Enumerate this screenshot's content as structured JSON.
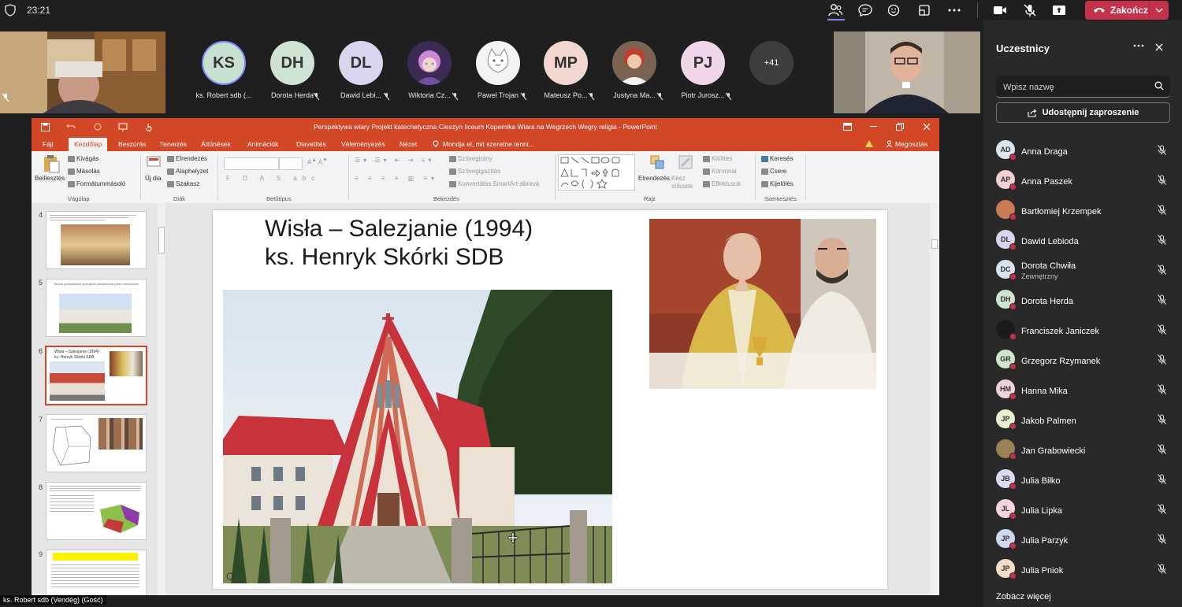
{
  "topbar": {
    "time": "23:21",
    "end_call_label": "Zakończ"
  },
  "strip": {
    "participants": [
      {
        "initials": "KS",
        "name": "ks. Robert sdb (...",
        "color": "#c8e0cf"
      },
      {
        "initials": "DH",
        "name": "Dorota Herda",
        "color": "#cfe3d3"
      },
      {
        "initials": "DL",
        "name": "Dawid Lebi...",
        "color": "#d8d6ef"
      },
      {
        "initials": "",
        "name": "Wiktoria Cz...",
        "color": "#7b5aa6"
      },
      {
        "initials": "",
        "name": "Paweł Trojan",
        "color": "#f4f4f4"
      },
      {
        "initials": "MP",
        "name": "Mateusz Po...",
        "color": "#f1d7cf"
      },
      {
        "initials": "",
        "name": "Justyna Ma...",
        "color": "#d8b28f"
      },
      {
        "initials": "PJ",
        "name": "Piotr Jurosz...",
        "color": "#f0d6e8"
      }
    ],
    "more_count": "+41"
  },
  "ppt": {
    "window_title": "Perspektywa wiary Projekt katechetyczna Cieszyn liceum Kopemika Wiara na Wegrzech Wegry religia - PowerPoint",
    "tabs": [
      "Fájl",
      "Kezdőlap",
      "Beszúrás",
      "Tervezés",
      "Áttűnések",
      "Animációk",
      "Diavetítés",
      "Véleményezés",
      "Nézet"
    ],
    "tell_me": "Mondja el, mit szeretne tenni...",
    "share": "Megosztás",
    "ribbon": {
      "paste": "Beillesztés",
      "cut": "Kivágás",
      "copy": "Másolás",
      "format_painter": "Formátummásoló",
      "clipboard": "Vágólap",
      "new_slide": "Új dia",
      "layout": "Elrendezés",
      "reset": "Alaphelyzet",
      "section": "Szakasz",
      "slides": "Diák",
      "font": "Betűtípus",
      "text_direction": "Szövegirány",
      "align_text": "Szövegigazítás",
      "smartart": "Konvertálás SmartArt-ábrává",
      "paragraph": "Bekezdés",
      "arrange": "Elrendezés",
      "quick_styles": "Kész stílusok",
      "shape_fill": "Kitöltés",
      "shape_outline": "Körvonal",
      "shape_effects": "Effektusok",
      "drawing": "Rajz",
      "find": "Keresés",
      "replace": "Csere",
      "select": "Kijelölés",
      "editing": "Szerkesztés"
    },
    "thumbnails": [
      "4",
      "5",
      "6",
      "7",
      "8",
      "9"
    ],
    "slide": {
      "title_line1": "Wisła – Salezjanie (1994)",
      "title_line2": "ks. Henryk Skórki SDB"
    },
    "thumb_texts": {
      "t5": "Szkoła podstawowa specjalna prowadzona przez salezjanów",
      "t6a": "Wisła – Salezjanie (1994)",
      "t6b": "ks. Henryk Skórki SDB"
    }
  },
  "panel": {
    "title": "Uczestnicy",
    "search_placeholder": "Wpisz nazwę",
    "share_invite": "Udostępnij zaproszenie",
    "participants": [
      {
        "initials": "AD",
        "name": "Anna Draga",
        "sub": "",
        "color": "#dde6ee"
      },
      {
        "initials": "AP",
        "name": "Anna Paszek",
        "sub": "",
        "color": "#f2cfd1"
      },
      {
        "initials": "",
        "name": "Bartłomiej Krzempek",
        "sub": "",
        "color": "#c97b54"
      },
      {
        "initials": "DL",
        "name": "Dawid Lebioda",
        "sub": "",
        "color": "#d8d6ef"
      },
      {
        "initials": "DC",
        "name": "Dorota Chwiła",
        "sub": "Zewnętrzny",
        "color": "#d6e4f2"
      },
      {
        "initials": "DH",
        "name": "Dorota Herda",
        "sub": "",
        "color": "#cfe3d3"
      },
      {
        "initials": "",
        "name": "Franciszek Janiczek",
        "sub": "",
        "color": "#1b1b1b"
      },
      {
        "initials": "GR",
        "name": "Grzegorz Rzymanek",
        "sub": "",
        "color": "#cfe6cf"
      },
      {
        "initials": "HM",
        "name": "Hanna Mika",
        "sub": "",
        "color": "#f0d3da"
      },
      {
        "initials": "JP",
        "name": "Jakob Palmen",
        "sub": "",
        "color": "#e8f0cf"
      },
      {
        "initials": "",
        "name": "Jan Grabowiecki",
        "sub": "",
        "color": "#9a8156"
      },
      {
        "initials": "JB",
        "name": "Julia Biłko",
        "sub": "",
        "color": "#d9dbee"
      },
      {
        "initials": "JL",
        "name": "Julia Lipka",
        "sub": "",
        "color": "#f4d4dc"
      },
      {
        "initials": "JP",
        "name": "Julia Parzyk",
        "sub": "",
        "color": "#cdd9f0"
      },
      {
        "initials": "JP",
        "name": "Julia Pniok",
        "sub": "",
        "color": "#f5dcc7"
      }
    ],
    "see_more": "Zobacz więcej"
  },
  "presenter_label": "ks. Robert sdb (Vendég) (Gość)"
}
